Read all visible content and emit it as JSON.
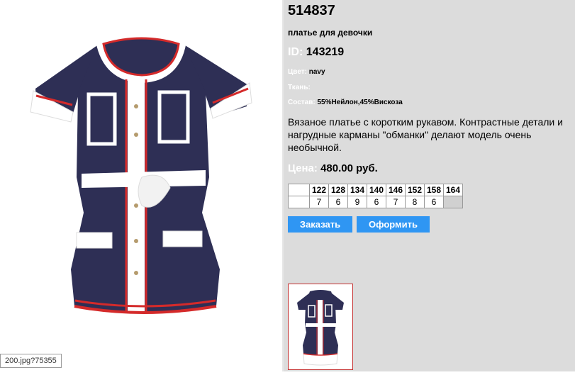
{
  "product": {
    "sku": "514837",
    "subtitle": "платье для девочки",
    "id_label": "ID:",
    "id_value": "143219",
    "color_label": "Цвет:",
    "color_value": "navy",
    "fabric_label": "Ткань:",
    "fabric_value": "",
    "composition_label": "Состав:",
    "composition_value": "55%Нейлон,45%Вискоза",
    "description": "Вязаное платье с коротким рукавом. Контрастные детали и нагрудные карманы \"обманки\" делают модель очень необычной.",
    "price_label": "Цена:",
    "price_value": "480.00 руб."
  },
  "sizes": {
    "headers": [
      "122",
      "128",
      "134",
      "140",
      "146",
      "152",
      "158",
      "164"
    ],
    "quantities": [
      "7",
      "6",
      "9",
      "6",
      "7",
      "8",
      "6",
      ""
    ]
  },
  "buttons": {
    "order": "Заказать",
    "checkout": "Оформить"
  },
  "status_bar": {
    "url_fragment": "200.jpg?75355"
  },
  "colors": {
    "accent": "#2f96f3",
    "navy": "#2e2f55",
    "trim_red": "#d42a2a",
    "panel_bg": "#dcdcdc"
  }
}
